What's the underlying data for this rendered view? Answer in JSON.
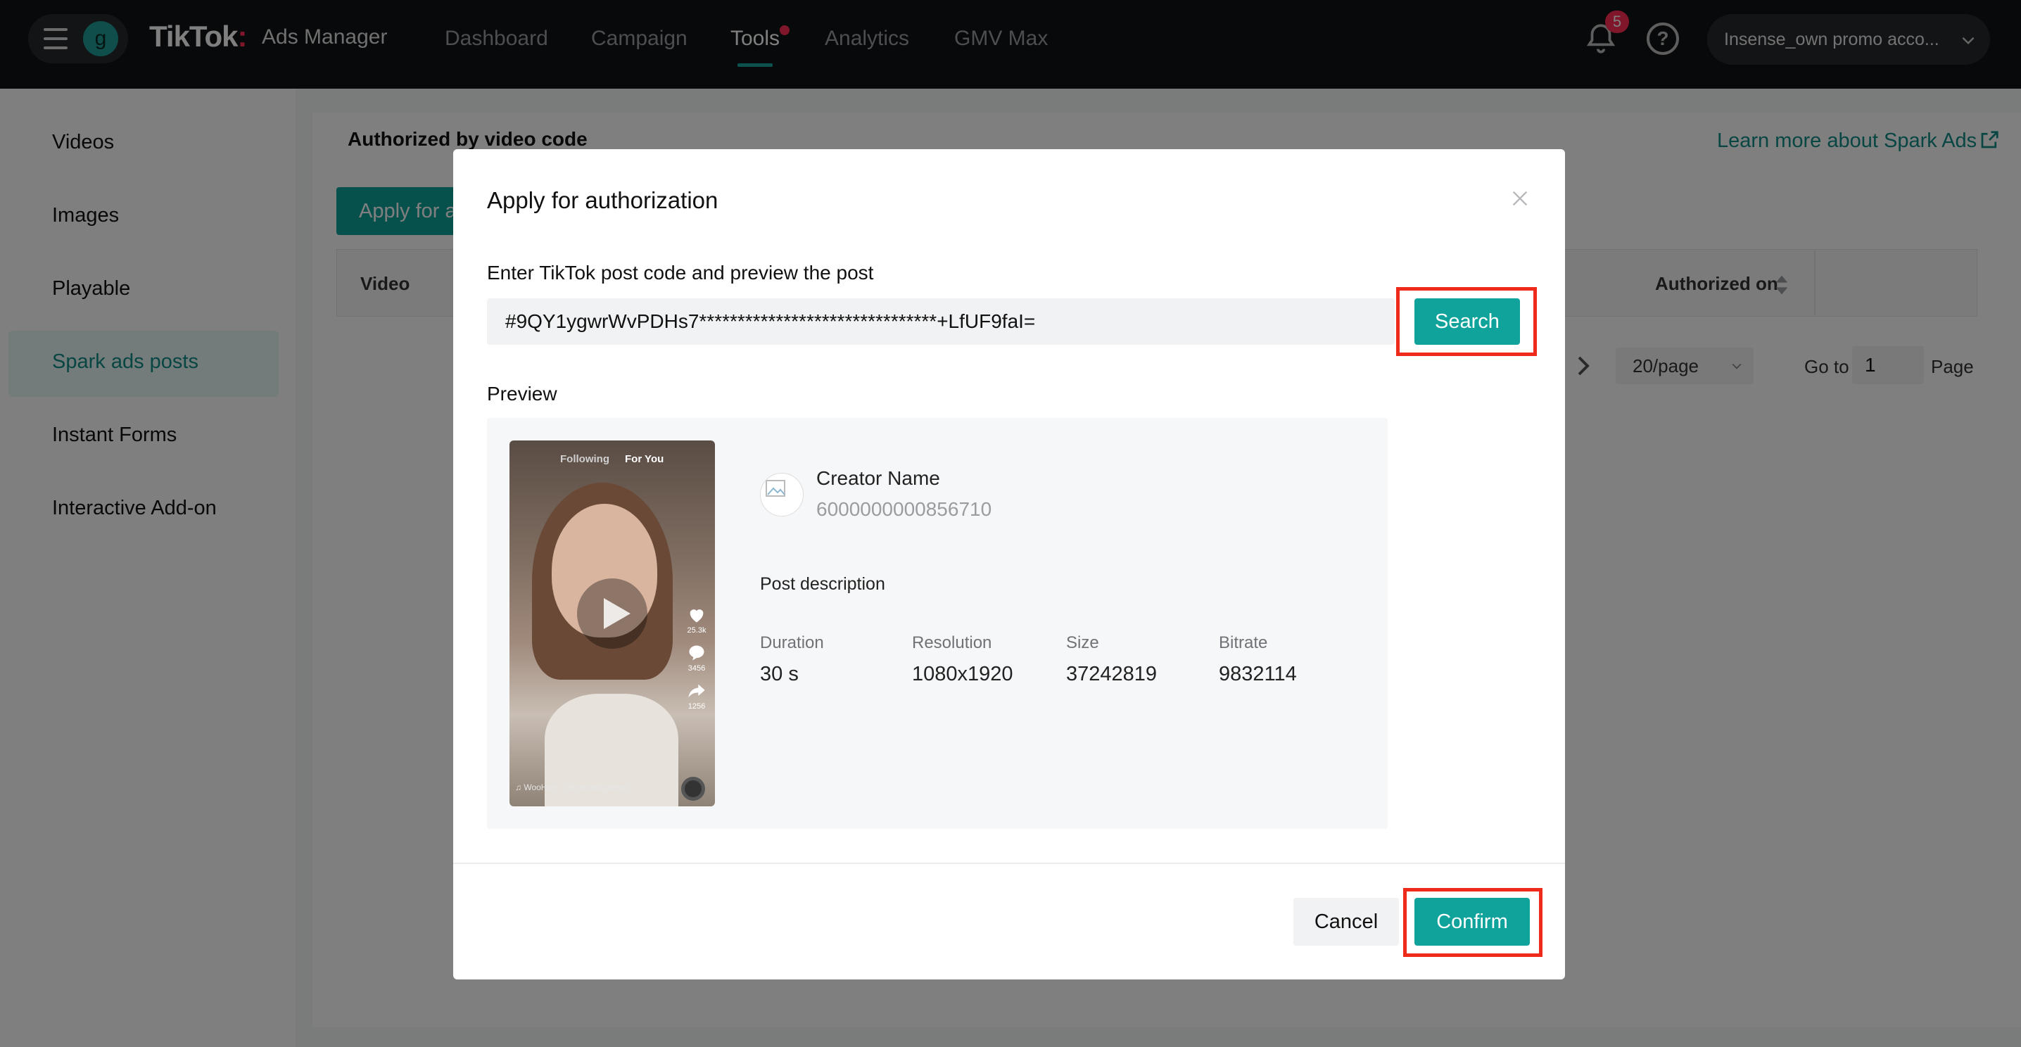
{
  "topbar": {
    "avatar_letter": "g",
    "logo": "TikTok",
    "logo_colon": ":",
    "logo_sub": "Ads Manager",
    "nav": [
      "Dashboard",
      "Campaign",
      "Tools",
      "Analytics",
      "GMV Max"
    ],
    "active_nav": "Tools",
    "notification_count": "5",
    "help_glyph": "?",
    "account": "Insense_own promo acco..."
  },
  "sidebar": {
    "items": [
      "Videos",
      "Images",
      "Playable",
      "Spark ads posts",
      "Instant Forms",
      "Interactive Add-on"
    ],
    "active": "Spark ads posts"
  },
  "main": {
    "tab": "Authorized by video code",
    "learn_more": "Learn more about Spark Ads",
    "apply_button": "Apply for authorization",
    "columns": {
      "video": "Video",
      "authorized_on": "Authorized on"
    },
    "pagination": {
      "page_size": "20/page",
      "goto_label": "Go to",
      "goto_value": "1",
      "page_label": "Page"
    }
  },
  "modal": {
    "title": "Apply for authorization",
    "field_label": "Enter TikTok post code and preview the post",
    "code_value": "#9QY1ygwrWvPDHs7*******************************+LfUF9faI=",
    "search_button": "Search",
    "preview_label": "Preview",
    "thumbnail": {
      "tab_following": "Following",
      "tab_for_you": "For You",
      "likes": "25.3k",
      "comments": "3456",
      "shares": "1256",
      "music": "♫ WooHoo · ChristinaAguilera"
    },
    "creator": {
      "name": "Creator Name",
      "id": "6000000000856710"
    },
    "post_description_label": "Post description",
    "meta": [
      {
        "label": "Duration",
        "value": "30 s"
      },
      {
        "label": "Resolution",
        "value": "1080x1920"
      },
      {
        "label": "Size",
        "value": "37242819"
      },
      {
        "label": "Bitrate",
        "value": "9832114"
      }
    ],
    "cancel_button": "Cancel",
    "confirm_button": "Confirm"
  },
  "colors": {
    "accent": "#0fa39b",
    "accent_text": "#0f8c86",
    "highlight": "#ee2a1b",
    "notification": "#fe2c55",
    "topbar_bg": "#111214"
  },
  "icons": {
    "menu": "hamburger-icon",
    "notifications": "bell-icon",
    "help": "help-icon",
    "account_dropdown": "chevron-down-icon",
    "external_link": "external-link-icon",
    "sort": "sort-icon",
    "close": "close-icon",
    "play": "play-icon"
  }
}
